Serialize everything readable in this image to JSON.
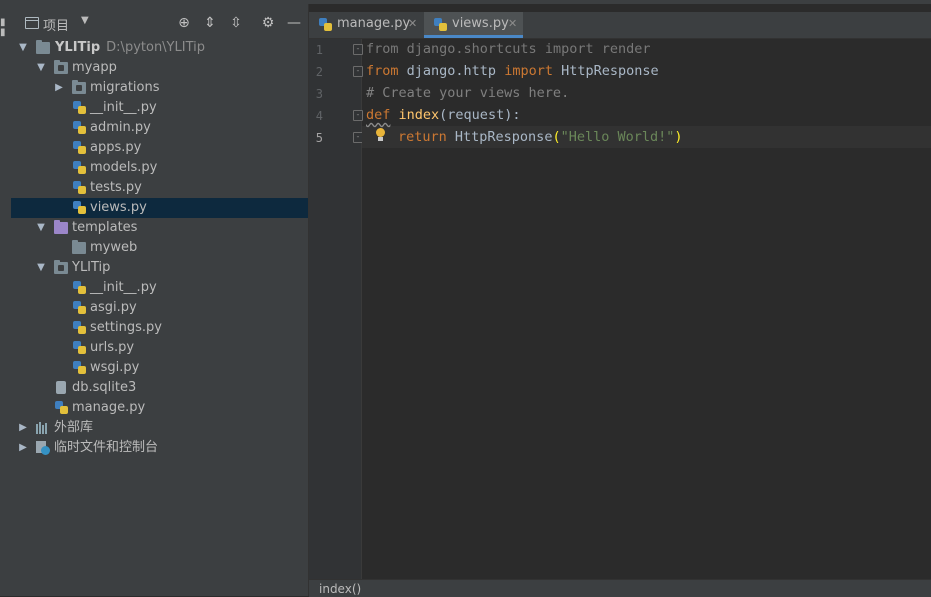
{
  "project_panel": {
    "title": "项目",
    "tree": [
      {
        "label": "YLITip",
        "path": "D:\\pyton\\YLITip"
      },
      {
        "label": "myapp"
      },
      {
        "label": "migrations"
      },
      {
        "label": "__init__.py"
      },
      {
        "label": "admin.py"
      },
      {
        "label": "apps.py"
      },
      {
        "label": "models.py"
      },
      {
        "label": "tests.py"
      },
      {
        "label": "views.py"
      },
      {
        "label": "templates"
      },
      {
        "label": "myweb"
      },
      {
        "label": "YLITip"
      },
      {
        "label": "__init__.py"
      },
      {
        "label": "asgi.py"
      },
      {
        "label": "settings.py"
      },
      {
        "label": "urls.py"
      },
      {
        "label": "wsgi.py"
      },
      {
        "label": "db.sqlite3"
      },
      {
        "label": "manage.py"
      },
      {
        "label": "外部库"
      },
      {
        "label": "临时文件和控制台"
      }
    ]
  },
  "tabs": [
    {
      "label": "manage.py",
      "active": false
    },
    {
      "label": "views.py",
      "active": true
    }
  ],
  "editor": {
    "line_numbers": [
      "1",
      "2",
      "3",
      "4",
      "5"
    ],
    "lines": [
      {
        "t1": "from",
        "t2": " django.shortcuts ",
        "t3": "import",
        "t4": " render"
      },
      {
        "t1": "from",
        "t2": " django.http ",
        "t3": "import",
        "t4": " HttpResponse"
      },
      {
        "t1": "# Create your views here."
      },
      {
        "t1": "def",
        "t2": " ",
        "t3": "index",
        "t4": "(request):"
      },
      {
        "t1": "return",
        "t2": " HttpResponse",
        "t3": "(",
        "t4": "\"Hello World!\"",
        "t5": ")"
      }
    ]
  },
  "status_bar": {
    "breadcrumb": "index()"
  }
}
